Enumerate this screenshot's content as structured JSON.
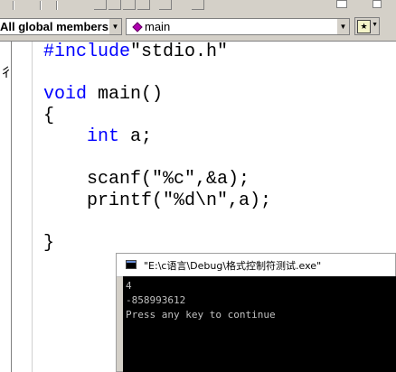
{
  "combos": {
    "members": "All global members",
    "function": "main"
  },
  "code_lines": [
    {
      "kw": "#include",
      "rest": "\"stdio.h\""
    },
    {
      "kw": "",
      "rest": ""
    },
    {
      "kw": "void",
      "rest": " main()"
    },
    {
      "kw": "",
      "rest": "{"
    },
    {
      "kw": "int",
      "rest": " a;",
      "indent": "    "
    },
    {
      "kw": "",
      "rest": ""
    },
    {
      "kw": "",
      "rest": "scanf(\"%c\",&a);",
      "indent": "    "
    },
    {
      "kw": "",
      "rest": "printf(\"%d\\n\",a);",
      "indent": "    "
    },
    {
      "kw": "",
      "rest": ""
    },
    {
      "kw": "",
      "rest": "}"
    }
  ],
  "console": {
    "title": "\"E:\\c语言\\Debug\\格式控制符测试.exe\"",
    "output_lines": [
      "4",
      "-858993612",
      "Press any key to continue"
    ]
  },
  "colors": {
    "keyword": "#0000ff",
    "ui_face": "#d4d0c8",
    "console_bg": "#000000",
    "console_text": "#c0c0c0"
  }
}
